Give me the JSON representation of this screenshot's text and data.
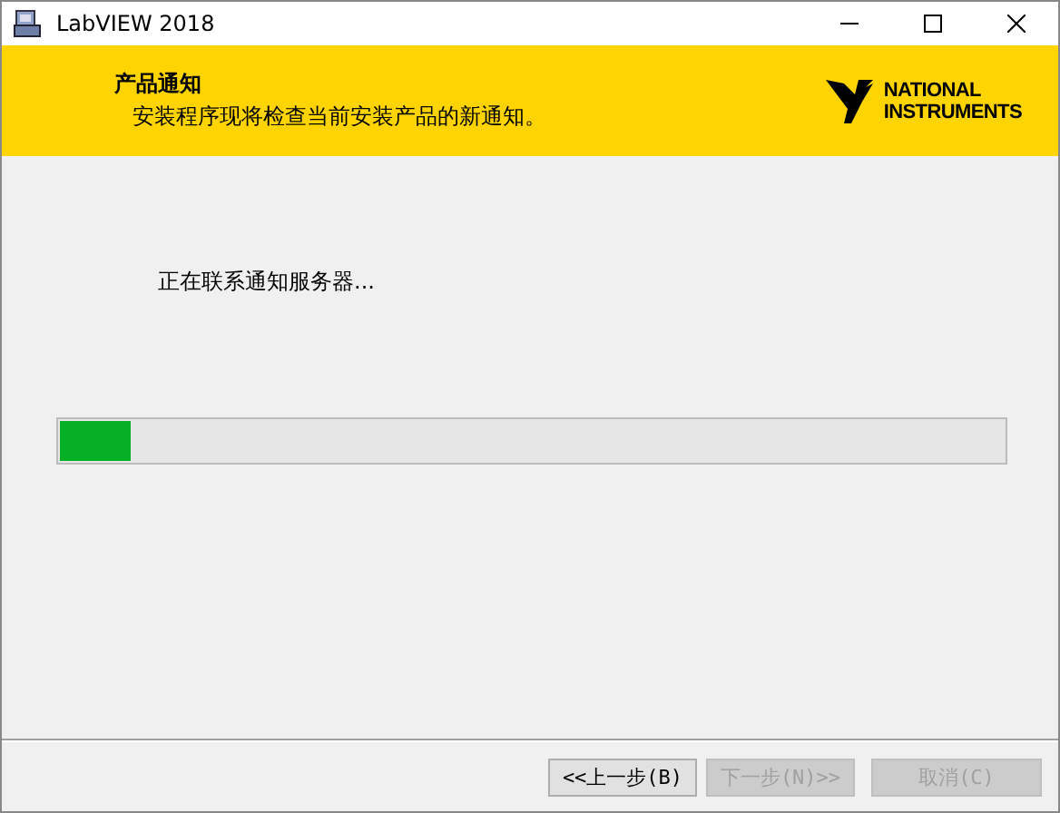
{
  "window": {
    "title": "LabVIEW 2018"
  },
  "header": {
    "title": "产品通知",
    "subtitle": "安装程序现将检查当前安装产品的新通知。",
    "logo_lines": [
      "NATIONAL",
      "INSTRUMENTS"
    ]
  },
  "status": {
    "message": "正在联系通知服务器...",
    "level": 0.075
  },
  "buttons": [
    {
      "label": "<<上一步(B)",
      "disabled": false
    },
    {
      "label": "下一步(N)>>",
      "disabled": true
    },
    {
      "label": "取消(C)",
      "disabled": true
    }
  ]
}
